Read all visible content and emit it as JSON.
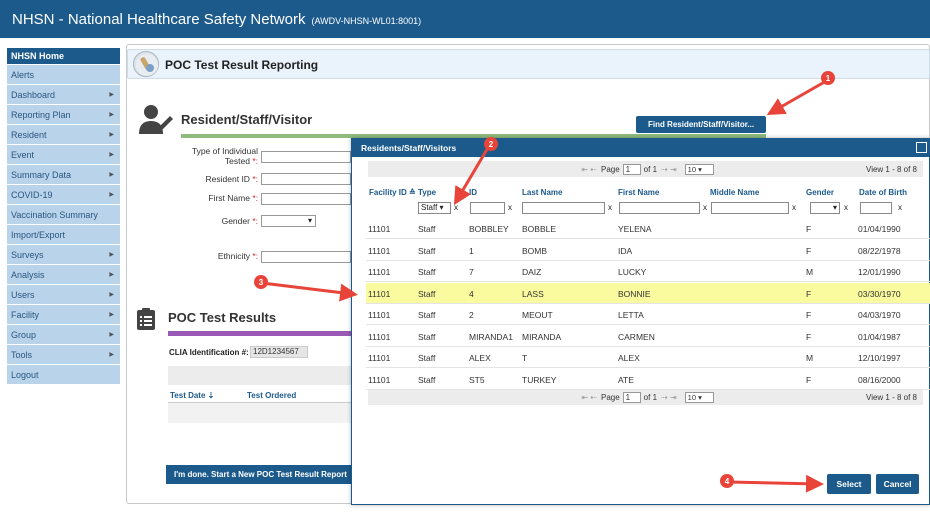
{
  "app": {
    "title": "NHSN - National Healthcare Safety Network",
    "server": "(AWDV-NHSN-WL01:8001)"
  },
  "sidebar": {
    "items": [
      {
        "label": "NHSN Home",
        "arrow": false
      },
      {
        "label": "Alerts",
        "arrow": false
      },
      {
        "label": "Dashboard",
        "arrow": true
      },
      {
        "label": "Reporting Plan",
        "arrow": true
      },
      {
        "label": "Resident",
        "arrow": true
      },
      {
        "label": "Event",
        "arrow": true
      },
      {
        "label": "Summary Data",
        "arrow": true
      },
      {
        "label": "COVID-19",
        "arrow": true
      },
      {
        "label": "Vaccination Summary",
        "arrow": false
      },
      {
        "label": "Import/Export",
        "arrow": false
      },
      {
        "label": "Surveys",
        "arrow": true
      },
      {
        "label": "Analysis",
        "arrow": true
      },
      {
        "label": "Users",
        "arrow": true
      },
      {
        "label": "Facility",
        "arrow": true
      },
      {
        "label": "Group",
        "arrow": true
      },
      {
        "label": "Tools",
        "arrow": true
      },
      {
        "label": "Logout",
        "arrow": false
      }
    ]
  },
  "page": {
    "title": "POC Test Result Reporting"
  },
  "rsv": {
    "title": "Resident/Staff/Visitor",
    "find_button": "Find Resident/Staff/Visitor...",
    "fields": {
      "type_label_1": "Type of Individual",
      "type_label_2": "Tested",
      "resident_id_label": "Resident ID",
      "first_name_label": "First Name",
      "gender_label": "Gender",
      "ethnicity_label": "Ethnicity",
      "required_mark": "*:"
    }
  },
  "results": {
    "title": "POC Test Results",
    "clia_label": "CLIA Identification #:",
    "clia_value": "12D1234567",
    "col_test_date": "Test Date",
    "col_test_ordered": "Test Ordered",
    "done_button": "I'm done.  Start a New POC Test Result Report"
  },
  "modal": {
    "title": "Residents/Staff/Visitors",
    "pager": {
      "page_label": "Page",
      "page_value": "1",
      "of_label": "of 1",
      "page_size": "10",
      "view_text": "View 1 - 8 of 8"
    },
    "columns": {
      "facility_id": "Facility ID",
      "type": "Type",
      "id": "ID",
      "last_name": "Last Name",
      "first_name": "First Name",
      "middle_name": "Middle Name",
      "gender": "Gender",
      "dob": "Date of Birth"
    },
    "filter": {
      "type_value": "Staff",
      "clear": "x"
    },
    "rows": [
      {
        "facility": "11101",
        "type": "Staff",
        "id": "BOBBLEY",
        "last": "BOBBLE",
        "first": "YELENA",
        "middle": "",
        "gender": "F",
        "dob": "01/04/1990"
      },
      {
        "facility": "11101",
        "type": "Staff",
        "id": "1",
        "last": "BOMB",
        "first": "IDA",
        "middle": "",
        "gender": "F",
        "dob": "08/22/1978"
      },
      {
        "facility": "11101",
        "type": "Staff",
        "id": "7",
        "last": "DAIZ",
        "first": "LUCKY",
        "middle": "",
        "gender": "M",
        "dob": "12/01/1990"
      },
      {
        "facility": "11101",
        "type": "Staff",
        "id": "4",
        "last": "LASS",
        "first": "BONNIE",
        "middle": "",
        "gender": "F",
        "dob": "03/30/1970"
      },
      {
        "facility": "11101",
        "type": "Staff",
        "id": "2",
        "last": "MEOUT",
        "first": "LETTA",
        "middle": "",
        "gender": "F",
        "dob": "04/03/1970"
      },
      {
        "facility": "11101",
        "type": "Staff",
        "id": "MIRANDA1",
        "last": "MIRANDA",
        "first": "CARMEN",
        "middle": "",
        "gender": "F",
        "dob": "01/04/1987"
      },
      {
        "facility": "11101",
        "type": "Staff",
        "id": "ALEX",
        "last": "T",
        "first": "ALEX",
        "middle": "",
        "gender": "M",
        "dob": "12/10/1997"
      },
      {
        "facility": "11101",
        "type": "Staff",
        "id": "ST5",
        "last": "TURKEY",
        "first": "ATE",
        "middle": "",
        "gender": "F",
        "dob": "08/16/2000"
      }
    ],
    "selected_row": 3,
    "select_button": "Select",
    "cancel_button": "Cancel"
  },
  "annotations": {
    "badges": [
      "1",
      "2",
      "3",
      "4"
    ],
    "arrow_color": "#e8443a"
  },
  "colors": {
    "primary": "#1c5a8c",
    "sidebar_bg": "#b9d3ea",
    "selected_row": "#fafa9e",
    "rsv_bar": "#8fbc7c",
    "results_bar": "#9b59b6",
    "required": "#dd2222"
  }
}
